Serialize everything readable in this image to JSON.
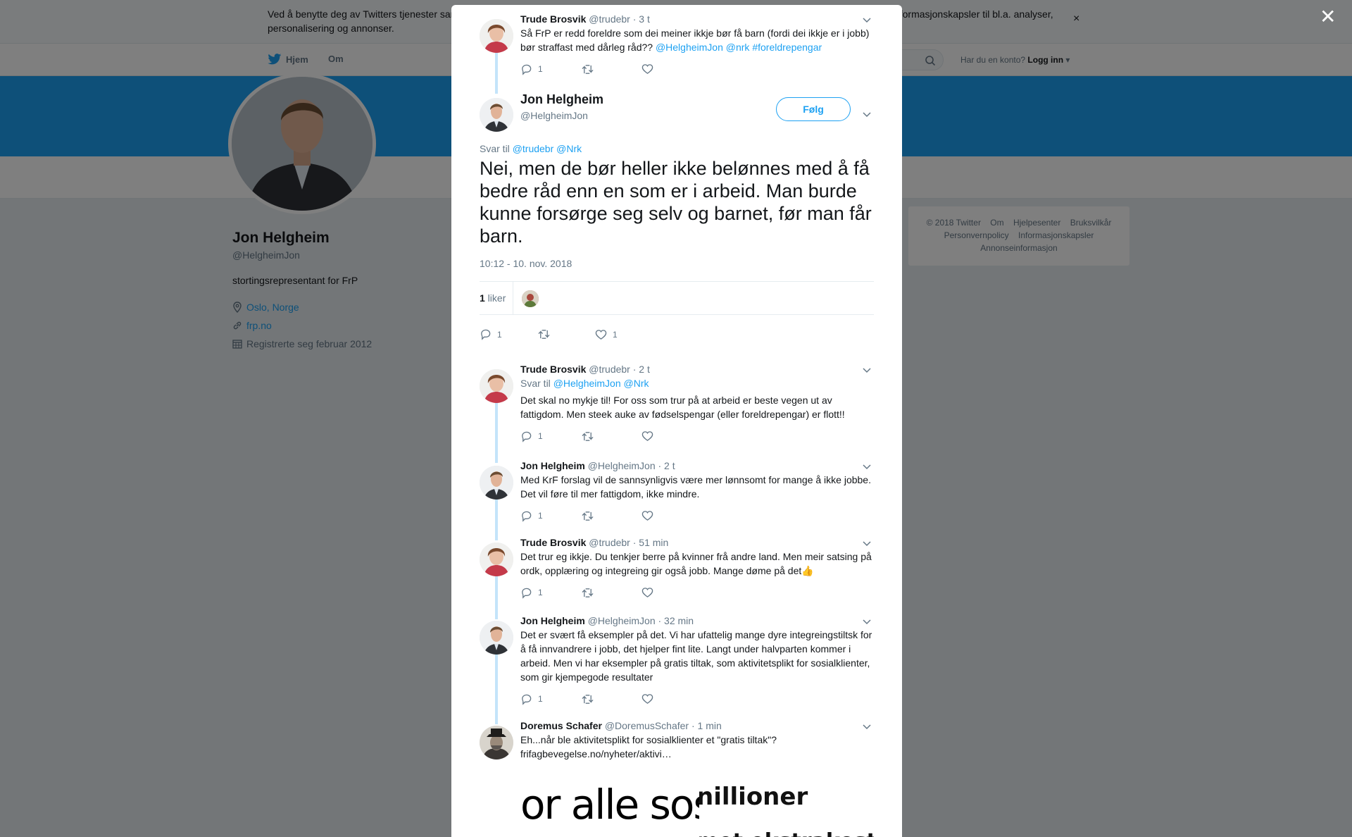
{
  "cookie_bar": {
    "text": "Ved å benytte deg av Twitters tjenester samtykker du til vår bruk av informasjonskapsler og deling av data med våre partnere, og til at vi bruker informasjonskapsler til bl.a. analyser, personalisering og annonser.",
    "close": "×"
  },
  "nav": {
    "home": "Hjem",
    "about": "Om",
    "login_prompt": "Har du en konto?",
    "login": "Logg inn"
  },
  "profile": {
    "name": "Jon Helgheim",
    "handle": "@HelgheimJon",
    "bio": "stortingsrepresentant for FrP",
    "location": "Oslo, Norge",
    "website": "frp.no",
    "joined": "Registrerte seg februar 2012"
  },
  "footer": {
    "line1": [
      "© 2018 Twitter",
      "Om",
      "Hjelpesenter",
      "Bruksvilkår"
    ],
    "line2": [
      "Personvernpolicy",
      "Informasjonskapsler"
    ],
    "line3": [
      "Annonseinformasjon"
    ]
  },
  "overlay_close": "✕",
  "parent_tweet": {
    "name": "Trude Brosvik",
    "handle": "@trudebr",
    "time": "· 3 t",
    "text": "Så FrP er redd foreldre som dei meiner ikkje bør få barn (fordi dei ikkje er i jobb) bør straffast med dårleg råd?? ",
    "mentions": "@HelgheimJon  @nrk #foreldrepengar",
    "replies": "1"
  },
  "main_tweet": {
    "name": "Jon Helgheim",
    "handle": "@HelgheimJon",
    "follow_label": "Følg",
    "reply_prefix": "Svar til ",
    "reply_to": "@trudebr @Nrk",
    "text": "Nei, men de bør heller ikke belønnes med å få bedre råd enn en som er i arbeid. Man burde kunne forsørge seg selv og barnet, før man får barn.",
    "timestamp": "10:12 - 10. nov. 2018",
    "likes_count": "1",
    "likes_label": " liker",
    "replies": "1",
    "likes": "1"
  },
  "replies": [
    {
      "name": "Trude Brosvik",
      "handle": "@trudebr",
      "time": "· 2 t",
      "reply_prefix": "Svar til ",
      "reply_to": "@HelgheimJon @Nrk",
      "text": "Det skal no mykje til! For oss som trur på at arbeid er beste vegen ut av fattigdom. Men steek auke av fødselspengar (eller foreldrepengar) er flott!!",
      "replies": "1"
    },
    {
      "name": "Jon Helgheim",
      "handle": "@HelgheimJon",
      "time": "· 2 t",
      "text": "Med KrF forslag vil de sannsynligvis være mer lønnsomt for mange å ikke jobbe. Det vil føre til mer fattigdom, ikke mindre.",
      "replies": "1"
    },
    {
      "name": "Trude Brosvik",
      "handle": "@trudebr",
      "time": "· 51 min",
      "text": "Det trur eg ikkje. Du tenkjer berre på kvinner frå andre land. Men meir satsing på ordk, opplæring og integreing gir også jobb. Mange døme på det",
      "emoji": "👍",
      "replies": "1"
    },
    {
      "name": "Jon Helgheim",
      "handle": "@HelgheimJon",
      "time": "· 32 min",
      "text": "Det er svært få eksempler på det. Vi har ufattelig mange dyre integreingstiltsk for å få innvandrere i jobb, det hjelper fint lite. Langt under halvparten kommer i arbeid. Men vi har eksempler på gratis tiltak, som aktivitetsplikt for sosialklienter, som gir kjempegode resultater",
      "replies": "1"
    },
    {
      "name": "Doremus Schafer",
      "handle": "@DoremusSchafer",
      "time": "· 1 min",
      "text": "Eh...når ble aktivitetsplikt for sosialklienter et \"gratis tiltak\"?",
      "link": "frifagbevegelse.no/nyheter/aktivi…"
    }
  ],
  "media": {
    "left_text": "or alle sosia",
    "right_text_1": "nillioner",
    "right_text_2": "met ekstrakostn"
  },
  "colors": {
    "accent": "#1da1f2",
    "text": "#14171a",
    "muted": "#657786",
    "thread_line": "#c4e4fa"
  }
}
